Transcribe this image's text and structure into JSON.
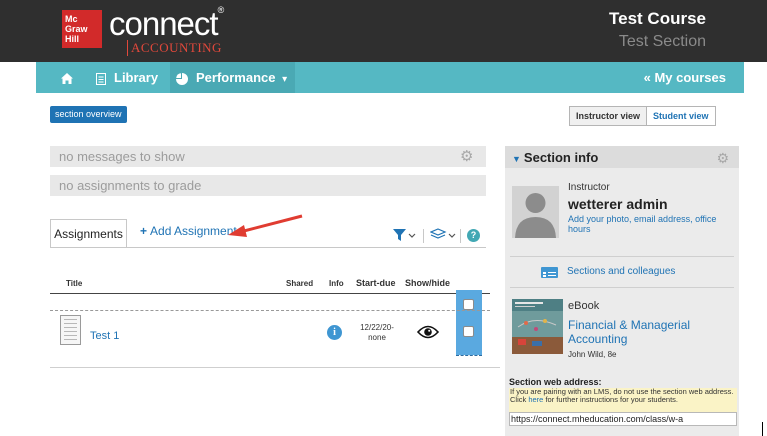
{
  "header": {
    "logo_text": "Mc Graw Hill",
    "brand": "connect",
    "brand_mark": "®",
    "subject": "ACCOUNTING",
    "course_title": "Test Course",
    "course_section": "Test Section"
  },
  "nav": {
    "home_icon": "home-icon",
    "library_label": "Library",
    "performance_label": "Performance",
    "performance_caret": "▾",
    "my_courses_label": "« My courses"
  },
  "toolbar": {
    "section_overview": "section overview",
    "instructor_view": "Instructor view",
    "student_view": "Student view"
  },
  "messages": {
    "no_messages": "no messages to show",
    "no_assignments": "no assignments to grade"
  },
  "assignments": {
    "tab_label": "Assignments",
    "add_label": "Add Assignment",
    "columns": {
      "title": "Title",
      "shared": "Shared",
      "info": "Info",
      "start_due": "Start-due",
      "show_hide": "Show/hide"
    },
    "rows": [
      {
        "title": "Test 1",
        "start": "12/22/20-",
        "due": "none"
      }
    ],
    "help_label": "?"
  },
  "section_info": {
    "title": "Section info",
    "instructor_label": "Instructor",
    "instructor_name": "wetterer admin",
    "instructor_link": "Add your photo, email address, office hours",
    "sections_link": "Sections and colleagues",
    "ebook_label": "eBook",
    "ebook_title": "Financial & Managerial Accounting",
    "ebook_author": "John Wild, 8e",
    "web_address_label": "Section web address:",
    "web_note_before": "If you are pairing with an LMS, do not use the section web address. Click ",
    "web_note_link": "here",
    "web_note_after": " for further instructions for your students.",
    "web_url": "https://connect.mheducation.com/class/w-a"
  },
  "colors": {
    "header_bg": "#2f2f2f",
    "nav_bg": "#55b8c3",
    "link_blue": "#1f73b4",
    "logo_red": "#d22a2a",
    "accounting_red": "#e2483b",
    "show_hide_column": "#5aa9e0",
    "annotation_arrow": "#e03c31"
  }
}
